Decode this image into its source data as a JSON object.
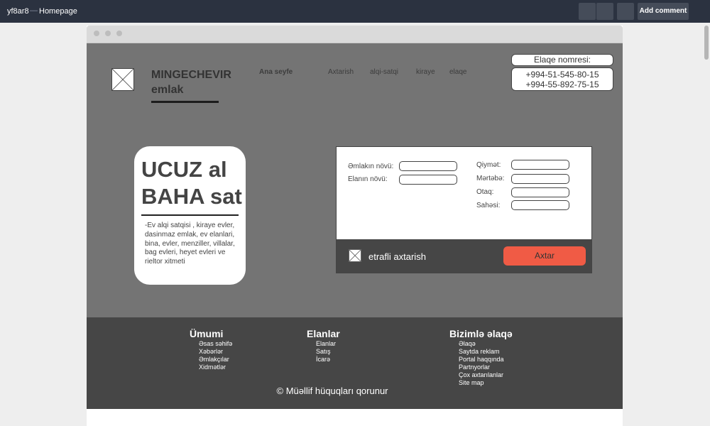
{
  "app": {
    "project": "yf8ar8",
    "separator": "—",
    "page_name": "Homepage",
    "add_comment": "Add comment"
  },
  "header": {
    "brand_line1": "MINGECHEVIR",
    "brand_line2": "emlak",
    "nav": [
      {
        "label": "Ana seyfe"
      },
      {
        "label": "Axtarish"
      },
      {
        "label": "alqi-satqi"
      },
      {
        "label": "kiraye"
      },
      {
        "label": "elaqe"
      }
    ],
    "contact_label": "Elaqe nomresi:",
    "phones": [
      "+994-51-545-80-15",
      "+994-55-892-75-15"
    ]
  },
  "promo": {
    "line1": "UCUZ al",
    "line2": "BAHA sat",
    "description": "-Ev alqi satqisi , kiraye evler, dasinmaz emlak, ev elanlari, bina, evler, menziller, villalar, bag evleri, heyet evleri ve rieltor xitmeti"
  },
  "search": {
    "fields_left": [
      {
        "label": "Əmlakın növü:"
      },
      {
        "label": "Elanın növü:"
      }
    ],
    "fields_right": [
      {
        "label": "Qiymət:"
      },
      {
        "label": "Mərtəbə:"
      },
      {
        "label": "Otaq:"
      },
      {
        "label": "Sahəsi:"
      }
    ],
    "advanced_label": "etrafli axtarish",
    "button_label": "Axtar"
  },
  "footer": {
    "columns": [
      {
        "title": "Ümumi",
        "links": [
          "Əsas səhifə",
          "Xəbərlər",
          "Əmlakçılar",
          "Xidmətlər"
        ]
      },
      {
        "title": "Elanlar",
        "links": [
          "Elanlar",
          "Satış",
          "İcarə"
        ]
      },
      {
        "title": "Bizimlə əlaqə",
        "links": [
          "Əlaqə",
          "Saytda reklam",
          "Portal haqqında",
          "Partnyorlar",
          "Çox axtarılanlar",
          "Site map"
        ]
      }
    ],
    "copyright": "© Müəllif hüquqları qorunur"
  },
  "colors": {
    "appbar": "#2b3240",
    "canvas": "#747474",
    "footer": "#464646",
    "accent": "#f05b45"
  }
}
